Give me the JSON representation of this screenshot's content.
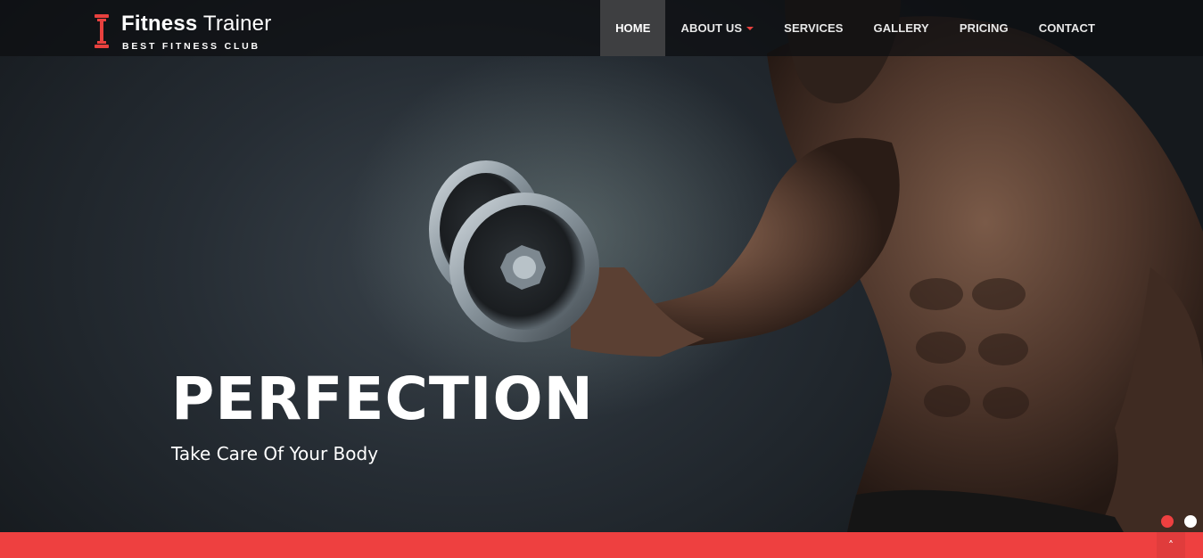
{
  "brand": {
    "title_bold": "Fitness",
    "title_light": " Trainer",
    "subtitle": "BEST FITNESS CLUB",
    "icon": "dumbbell-icon",
    "accent_color": "#e8413e"
  },
  "nav": {
    "items": [
      {
        "label": "HOME",
        "active": true
      },
      {
        "label": "ABOUT US",
        "dropdown": true
      },
      {
        "label": "SERVICES"
      },
      {
        "label": "GALLERY"
      },
      {
        "label": "PRICING"
      },
      {
        "label": "CONTACT"
      }
    ]
  },
  "hero": {
    "title": "PERFECTION",
    "subtitle": "Take Care Of Your Body",
    "image": "bodybuilder-with-dumbbell"
  },
  "slider": {
    "dot_count": 2,
    "active_index": 0,
    "active_color": "#ee4040",
    "inactive_color": "#ffffff"
  },
  "footer_bar": {
    "color": "#ee4040",
    "scroll_top_icon": "chevron-up-icon",
    "scroll_top_glyph": "˄"
  }
}
